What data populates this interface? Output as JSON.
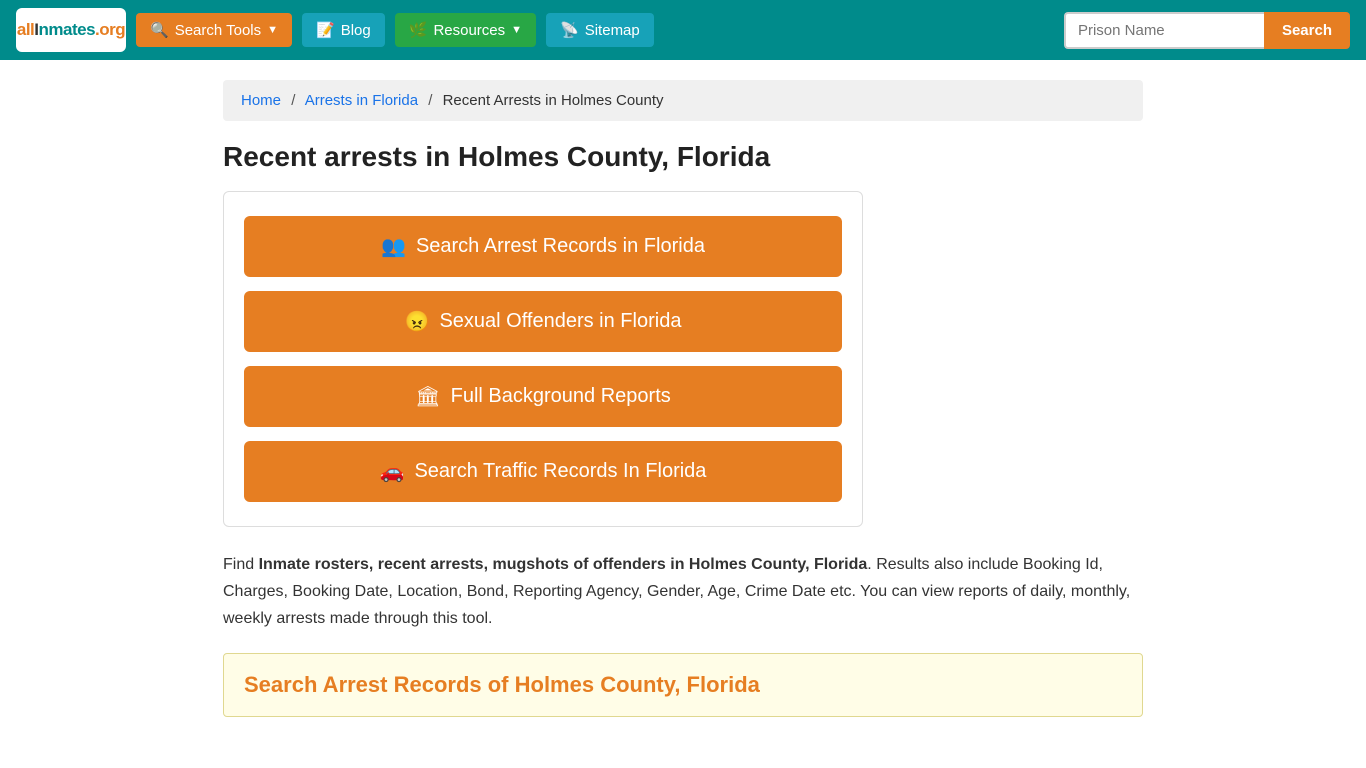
{
  "header": {
    "logo_text": "allInmates.org",
    "logo_all": "all",
    "logo_in": "I",
    "logo_mates": "nmates",
    "logo_dot": ".",
    "logo_org": "org",
    "nav": [
      {
        "id": "search-tools",
        "label": "Search Tools",
        "icon": "🔍",
        "dropdown": true,
        "style": "orange"
      },
      {
        "id": "blog",
        "label": "Blog",
        "icon": "📝",
        "dropdown": false,
        "style": "teal"
      },
      {
        "id": "resources",
        "label": "Resources",
        "icon": "🌿",
        "dropdown": true,
        "style": "green"
      },
      {
        "id": "sitemap",
        "label": "Sitemap",
        "icon": "📡",
        "dropdown": false,
        "style": "teal"
      }
    ],
    "search_placeholder": "Prison Name",
    "search_button": "Search"
  },
  "breadcrumb": {
    "home": "Home",
    "arrests": "Arrests in Florida",
    "current": "Recent Arrests in Holmes County"
  },
  "page_title": "Recent arrests in Holmes County, Florida",
  "action_buttons": [
    {
      "id": "arrest-records",
      "icon": "👥",
      "label": "Search Arrest Records in Florida"
    },
    {
      "id": "sexual-offenders",
      "icon": "😠",
      "label": "Sexual Offenders in Florida"
    },
    {
      "id": "background-reports",
      "icon": "🏛",
      "label": "Full Background Reports"
    },
    {
      "id": "traffic-records",
      "icon": "🚗",
      "label": "Search Traffic Records In Florida"
    }
  ],
  "description": {
    "intro": "Find ",
    "bold_text": "Inmate rosters, recent arrests, mugshots of offenders in Holmes County, Florida",
    "rest": ". Results also include Booking Id, Charges, Booking Date, Location, Bond, Reporting Agency, Gender, Age, Crime Date etc. You can view reports of daily, monthly, weekly arrests made through this tool."
  },
  "search_section_title": "Search Arrest Records of Holmes County, Florida"
}
